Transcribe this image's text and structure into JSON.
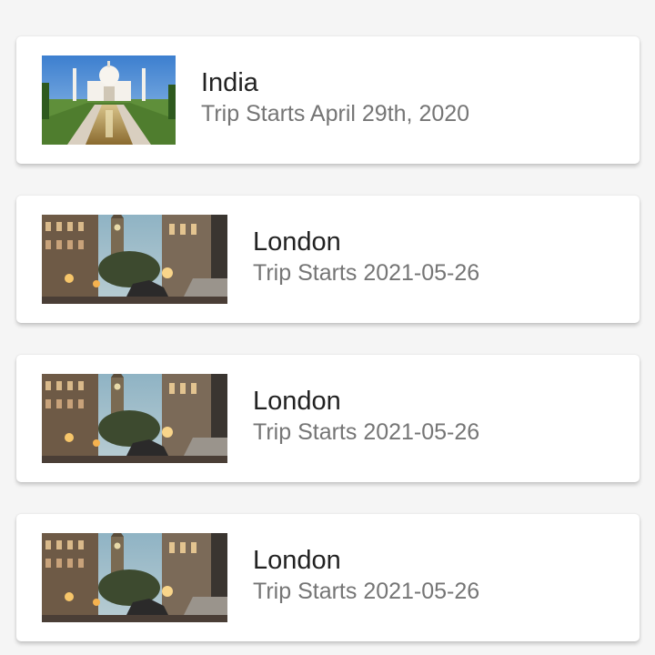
{
  "trips": [
    {
      "title": "India",
      "subtitle": "Trip Starts April 29th, 2020",
      "image": "taj-mahal-photo"
    },
    {
      "title": "London",
      "subtitle": "Trip Starts 2021-05-26",
      "image": "london-street-photo"
    },
    {
      "title": "London",
      "subtitle": "Trip Starts 2021-05-26",
      "image": "london-street-photo"
    },
    {
      "title": "London",
      "subtitle": "Trip Starts 2021-05-26",
      "image": "london-street-photo"
    }
  ],
  "colors": {
    "background": "#f5f5f5",
    "card": "#ffffff",
    "title_text": "#222222",
    "subtitle_text": "#757575"
  }
}
